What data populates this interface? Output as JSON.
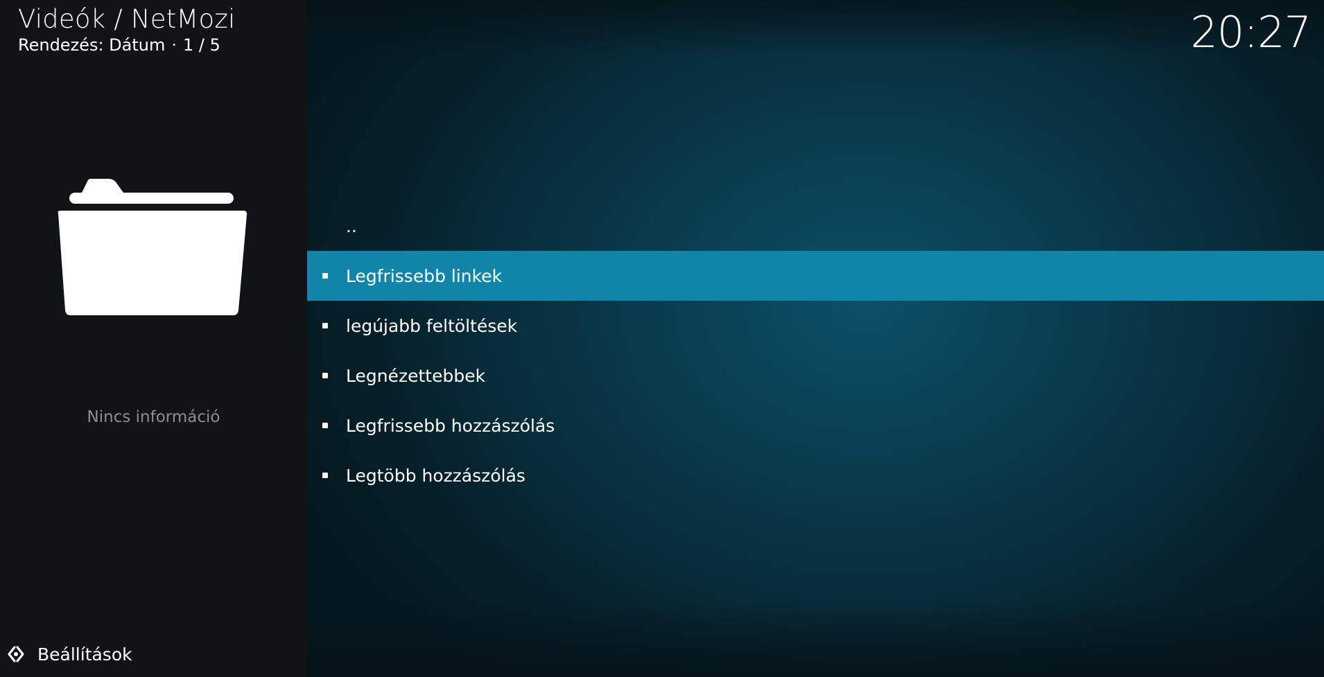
{
  "header": {
    "title": "Videók / NetMozi",
    "sort_label": "Rendezés: Dátum",
    "separator": "·",
    "page_counter": "1 / 5"
  },
  "clock": {
    "time": "20:27"
  },
  "sidebar": {
    "thumbnail_icon": "folder-icon",
    "info_text": "Nincs információ",
    "settings": {
      "icon": "settings-gear-icon",
      "label": "Beállítások"
    }
  },
  "list": {
    "parent": "..",
    "items": [
      {
        "label": "Legfrissebb linkek",
        "focused": true
      },
      {
        "label": "legújabb feltöltések",
        "focused": false
      },
      {
        "label": "Legnézettebbek",
        "focused": false
      },
      {
        "label": "Legfrissebb hozzászólás",
        "focused": false
      },
      {
        "label": "Legtöbb hozzászólás",
        "focused": false
      }
    ]
  },
  "colors": {
    "focus_highlight": "#0f86a7",
    "sidebar_bg": "#111416",
    "main_bg": "#0a3e52",
    "muted_text": "#8b8f92"
  }
}
